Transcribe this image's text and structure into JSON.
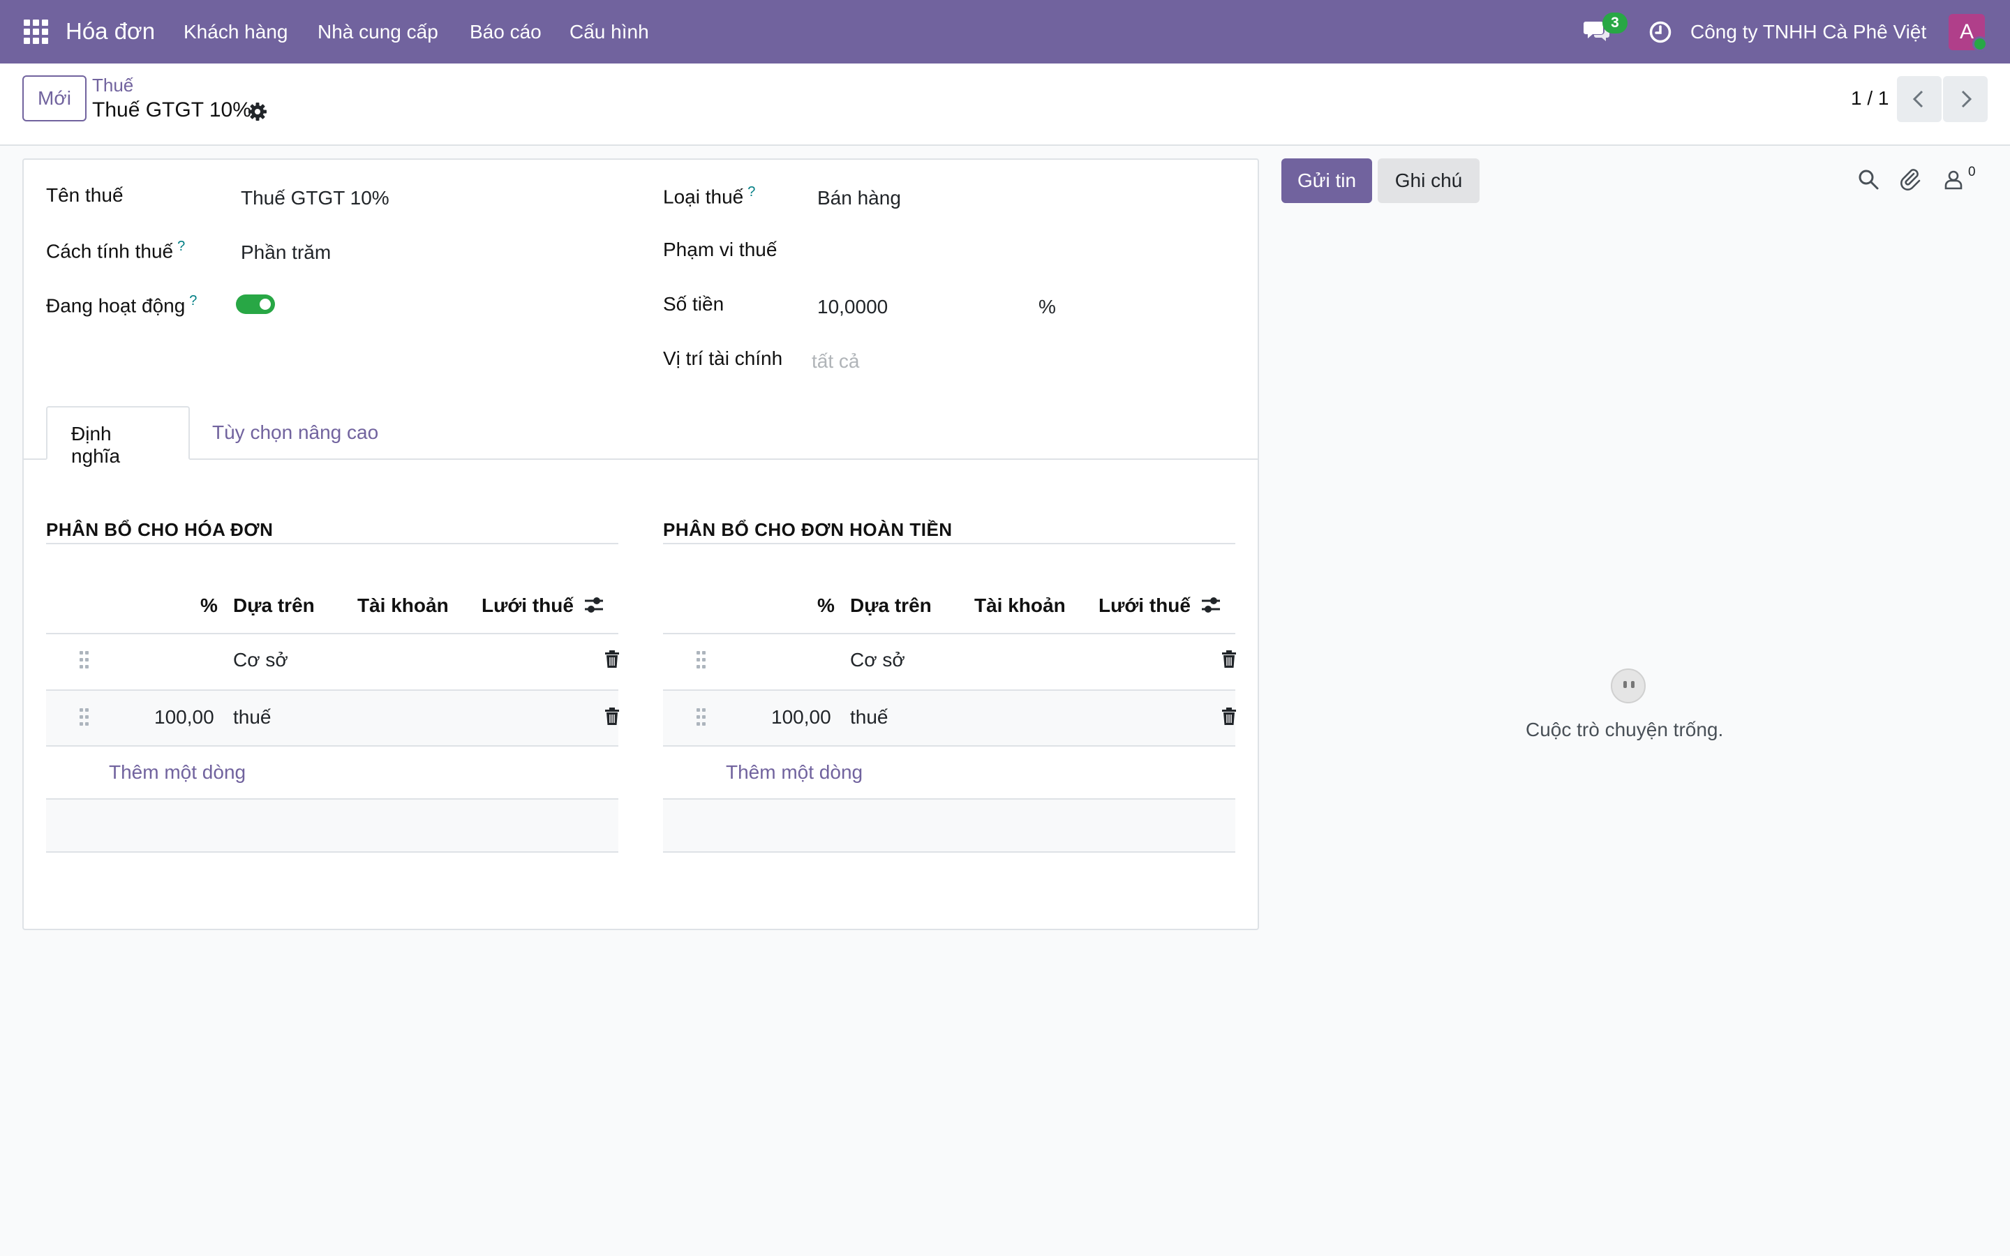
{
  "navbar": {
    "app_title": "Hóa đơn",
    "menu": [
      "Khách hàng",
      "Nhà cung cấp",
      "Báo cáo",
      "Cấu hình"
    ],
    "chat_badge": "3",
    "company": "Công ty TNHH Cà Phê Việt",
    "avatar_letter": "A",
    "accent_color": "#71639e"
  },
  "control_panel": {
    "new_button": "Mới",
    "breadcrumb_parent": "Thuế",
    "breadcrumb_current": "Thuế GTGT 10%",
    "pager": "1 / 1"
  },
  "form": {
    "left": [
      {
        "label": "Tên thuế",
        "value": "Thuế GTGT 10%",
        "help": ""
      },
      {
        "label": "Cách tính thuế",
        "value": "Phần trăm",
        "help": "?"
      },
      {
        "label": "Đang hoạt động",
        "value": "",
        "help": "?"
      }
    ],
    "active": true,
    "right": [
      {
        "label": "Loại thuế",
        "value": "Bán hàng",
        "help": "?"
      },
      {
        "label": "Phạm vi thuế",
        "value": "",
        "help": ""
      },
      {
        "label": "Số tiền",
        "value": "10,0000",
        "help": ""
      },
      {
        "label": "Vị trí tài chính",
        "value": "",
        "help": ""
      }
    ],
    "amount_unit": "%",
    "fiscal_placeholder": "tất cả"
  },
  "tabs": [
    "Định nghĩa",
    "Tùy chọn nâng cao"
  ],
  "sections": [
    {
      "title": "PHÂN BỔ CHO HÓA ĐƠN",
      "headers": [
        "%",
        "Dựa trên",
        "Tài khoản",
        "Lưới thuế"
      ],
      "rows": [
        {
          "percent": "",
          "base": "Cơ sở"
        },
        {
          "percent": "100,00",
          "base": "thuế"
        }
      ],
      "add_line": "Thêm một dòng"
    },
    {
      "title": "PHÂN BỔ CHO ĐƠN HOÀN TIỀN",
      "headers": [
        "%",
        "Dựa trên",
        "Tài khoản",
        "Lưới thuế"
      ],
      "rows": [
        {
          "percent": "",
          "base": "Cơ sở"
        },
        {
          "percent": "100,00",
          "base": "thuế"
        }
      ],
      "add_line": "Thêm một dòng"
    }
  ],
  "chatter": {
    "send_button": "Gửi tin",
    "note_button": "Ghi chú",
    "followers_count": "0",
    "empty_text": "Cuộc trò chuyện trống."
  }
}
